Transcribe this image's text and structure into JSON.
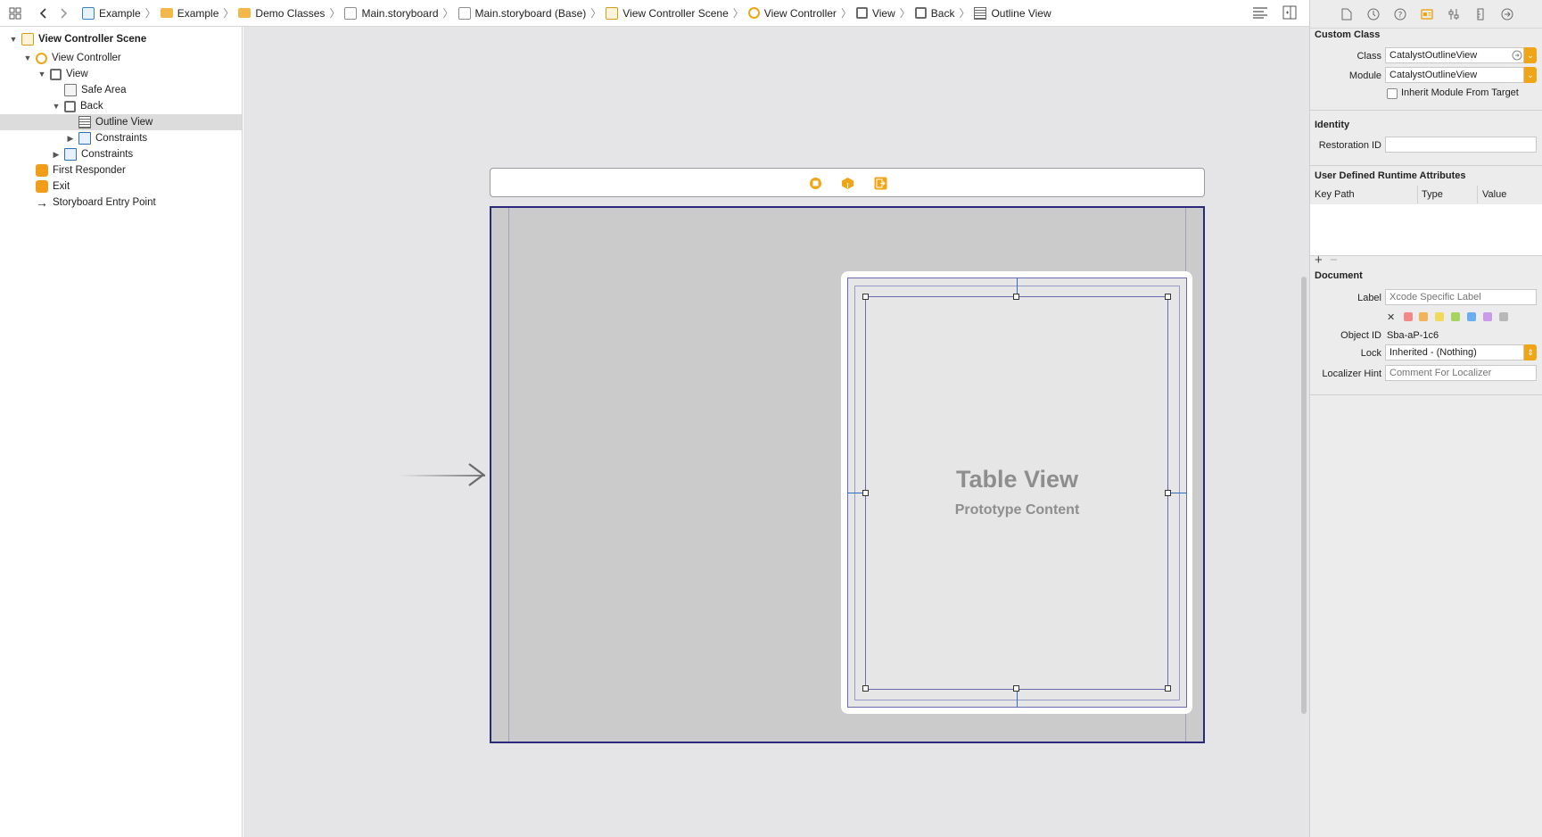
{
  "breadcrumbs": [
    {
      "label": "Example",
      "icon": "swift-file-icon"
    },
    {
      "label": "Example",
      "icon": "folder-icon"
    },
    {
      "label": "Demo Classes",
      "icon": "folder-icon"
    },
    {
      "label": "Main.storyboard",
      "icon": "storyboard-icon"
    },
    {
      "label": "Main.storyboard (Base)",
      "icon": "storyboard-icon"
    },
    {
      "label": "View Controller Scene",
      "icon": "scene-icon"
    },
    {
      "label": "View Controller",
      "icon": "view-controller-icon"
    },
    {
      "label": "View",
      "icon": "view-icon"
    },
    {
      "label": "Back",
      "icon": "view-icon"
    },
    {
      "label": "Outline View",
      "icon": "table-view-icon"
    }
  ],
  "outline": {
    "scene": "View Controller Scene",
    "view_controller": "View Controller",
    "view": "View",
    "safe_area": "Safe Area",
    "back": "Back",
    "outline_view": "Outline View",
    "constraints_inner": "Constraints",
    "constraints_outer": "Constraints",
    "first_responder": "First Responder",
    "exit": "Exit",
    "entry_point": "Storyboard Entry Point"
  },
  "canvas": {
    "table_view_title": "Table View",
    "table_view_subtitle": "Prototype Content"
  },
  "inspector": {
    "custom_class": {
      "title": "Custom Class",
      "class_label": "Class",
      "class_value": "CatalystOutlineView",
      "module_label": "Module",
      "module_value": "CatalystOutlineView",
      "inherit_label": "Inherit Module From Target",
      "inherit_checked": false
    },
    "identity": {
      "title": "Identity",
      "restoration_label": "Restoration ID",
      "restoration_value": ""
    },
    "udra": {
      "title": "User Defined Runtime Attributes",
      "col_key_path": "Key Path",
      "col_type": "Type",
      "col_value": "Value"
    },
    "document": {
      "title": "Document",
      "label_label": "Label",
      "label_placeholder": "Xcode Specific Label",
      "object_id_label": "Object ID",
      "object_id_value": "Sba-aP-1c6",
      "lock_label": "Lock",
      "lock_value": "Inherited - (Nothing)",
      "localizer_label": "Localizer Hint",
      "localizer_placeholder": "Comment For Localizer",
      "label_colors": [
        "#f08a8a",
        "#f4b35a",
        "#f2d95a",
        "#a6d45e",
        "#6aaef0",
        "#c89ae8",
        "#b8b8b8"
      ]
    }
  }
}
